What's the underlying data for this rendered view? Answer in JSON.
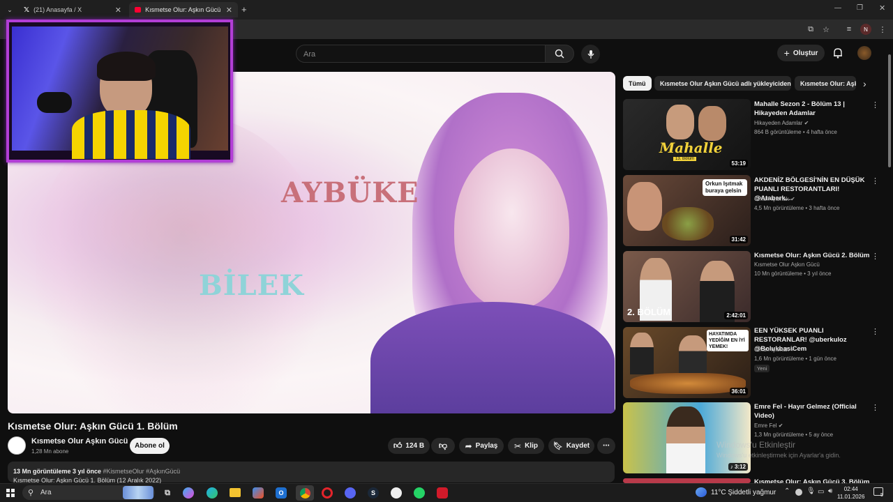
{
  "browser": {
    "tabs": [
      {
        "label": "(21) Anasayfa / X"
      },
      {
        "label": "Kısmetse Olur: Aşkın Gücü 1. Bö"
      }
    ],
    "new_tab": "+",
    "profile_initial": "N"
  },
  "header": {
    "search_placeholder": "Ara",
    "create_label": "Oluştur"
  },
  "player": {
    "overlay_name1": "AYBÜKE",
    "overlay_name2": "BİLEK"
  },
  "video": {
    "title": "Kısmetse Olur: Aşkın Gücü 1. Bölüm",
    "channel": "Kısmetse Olur Aşkın Gücü",
    "subscribers": "1,28 Mn abone",
    "subscribe_label": "Abone ol",
    "likes": "124 B",
    "share_label": "Paylaş",
    "clip_label": "Klip",
    "save_label": "Kaydet",
    "views_line": "13 Mn görüntüleme  3 yıl önce",
    "hashtags": "#KismetseOlur #AşkınGücü",
    "description": "Kısmetse Olur: Aşkın Gücü 1. Bölüm (12 Aralık 2022)"
  },
  "chips": [
    {
      "label": "Tümü"
    },
    {
      "label": "Kısmetse Olur Aşkın Gücü adlı yükleyiciden"
    },
    {
      "label": "Kısmetse Olur: Aşkı"
    }
  ],
  "recommendations": [
    {
      "title": "Mahalle Sezon 2 - Bölüm 13 | Hikayeden Adamlar",
      "channel": "Hikayeden Adamlar",
      "meta": "864 B görüntüleme • 4 hafta önce",
      "duration": "53:19",
      "thumb_text": "Mahalle",
      "thumb_sub": "13. Bölüm"
    },
    {
      "title": "AKDENİZ BÖLGESİ'NİN EN DÜŞÜK PUANLI RESTORANTLARI! @Ataberk...",
      "channel": "Orkun Işıtmak",
      "meta": "4,5 Mn görüntüleme • 3 hafta önce",
      "duration": "31:42",
      "thumb_text": "Orkun Işıtmak buraya gelsin"
    },
    {
      "title": "Kısmetse Olur: Aşkın Gücü 2. Bölüm",
      "channel": "Kısmetse Olur Aşkın Gücü",
      "meta": "10 Mn görüntüleme • 3 yıl önce",
      "duration": "2:42:01",
      "thumb_text": "2. BÖLÜM"
    },
    {
      "title": "EEN YÜKSEK PUANLI RESTORANLAR! @uberkuloz @BolukbasiCem",
      "channel": "Orkun Işıtmak",
      "meta": "1,6 Mn görüntüleme • 1 gün önce",
      "duration": "36:01",
      "badge": "Yeni",
      "thumb_text": "HAYATIMDA YEDİĞİM EN İYİ YEMEK!"
    },
    {
      "title": "Emre Fel - Hayır Gelmez (Official Video)",
      "channel": "Emre Fel",
      "meta": "1,3 Mn görüntüleme • 5 ay önce",
      "duration": "3:12"
    },
    {
      "title": "Kısmetse Olur: Aşkın Gücü 3. Bölüm"
    }
  ],
  "watermark": {
    "line1": "Windows'u Etkinleştir",
    "line2": "Windows'u etkinleştirmek için Ayarlar'a gidin."
  },
  "taskbar": {
    "search_label": "Ara",
    "weather": "11°C  Şiddetli yağmur",
    "time": "02:44",
    "date": "11.01.2026",
    "notification_count": "5"
  },
  "colors": {
    "accent_purple": "#b23ed6",
    "youtube_red": "#ff0033"
  }
}
